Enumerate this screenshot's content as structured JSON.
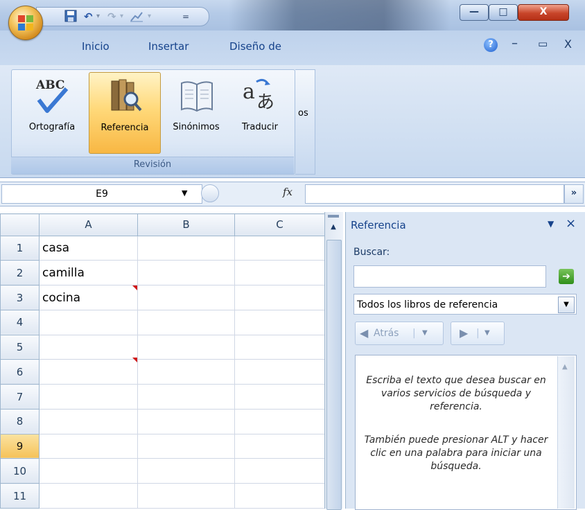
{
  "titlebar": {
    "min_symbol": "—",
    "max_symbol": "□",
    "close_symbol": "X",
    "qat_dropdown": "="
  },
  "tabs": {
    "inicio": "Inicio",
    "insertar": "Insertar",
    "diseno": "Diseño de",
    "help": "?",
    "win_min": "–",
    "win_restore": "▭",
    "win_close": "X"
  },
  "ribbon": {
    "group_label": "Revisión",
    "buttons": [
      "Ortografía",
      "Referencia",
      "Sinónimos",
      "Traducir"
    ],
    "overflow": "os"
  },
  "formula_bar": {
    "name_box": "E9",
    "fx": "fx",
    "expand": "»"
  },
  "sheet": {
    "columns": [
      "A",
      "B",
      "C"
    ],
    "rows": [
      {
        "num": "1",
        "a": "casa"
      },
      {
        "num": "2",
        "a": "camilla"
      },
      {
        "num": "3",
        "a": "cocina"
      },
      {
        "num": "4",
        "a": ""
      },
      {
        "num": "5",
        "a": ""
      },
      {
        "num": "6",
        "a": ""
      },
      {
        "num": "7",
        "a": ""
      },
      {
        "num": "8",
        "a": ""
      },
      {
        "num": "9",
        "a": ""
      },
      {
        "num": "10",
        "a": ""
      },
      {
        "num": "11",
        "a": ""
      }
    ],
    "active_row": "9"
  },
  "pane": {
    "title": "Referencia",
    "dropdown_glyph": "▼",
    "close_glyph": "×",
    "search_label": "Buscar:",
    "search_value": "",
    "go_glyph": "➔",
    "books_select": "Todos los libros de referencia",
    "back_label": "Atrás",
    "help1": "Escriba el texto que desea buscar en varios servicios de búsqueda y referencia.",
    "help2": "También puede presionar ALT y hacer clic en una palabra para iniciar una búsqueda."
  },
  "colors": {
    "ribbon_text": "#15428b",
    "active_button": "#ffd97a",
    "close_button": "#c8452a"
  }
}
